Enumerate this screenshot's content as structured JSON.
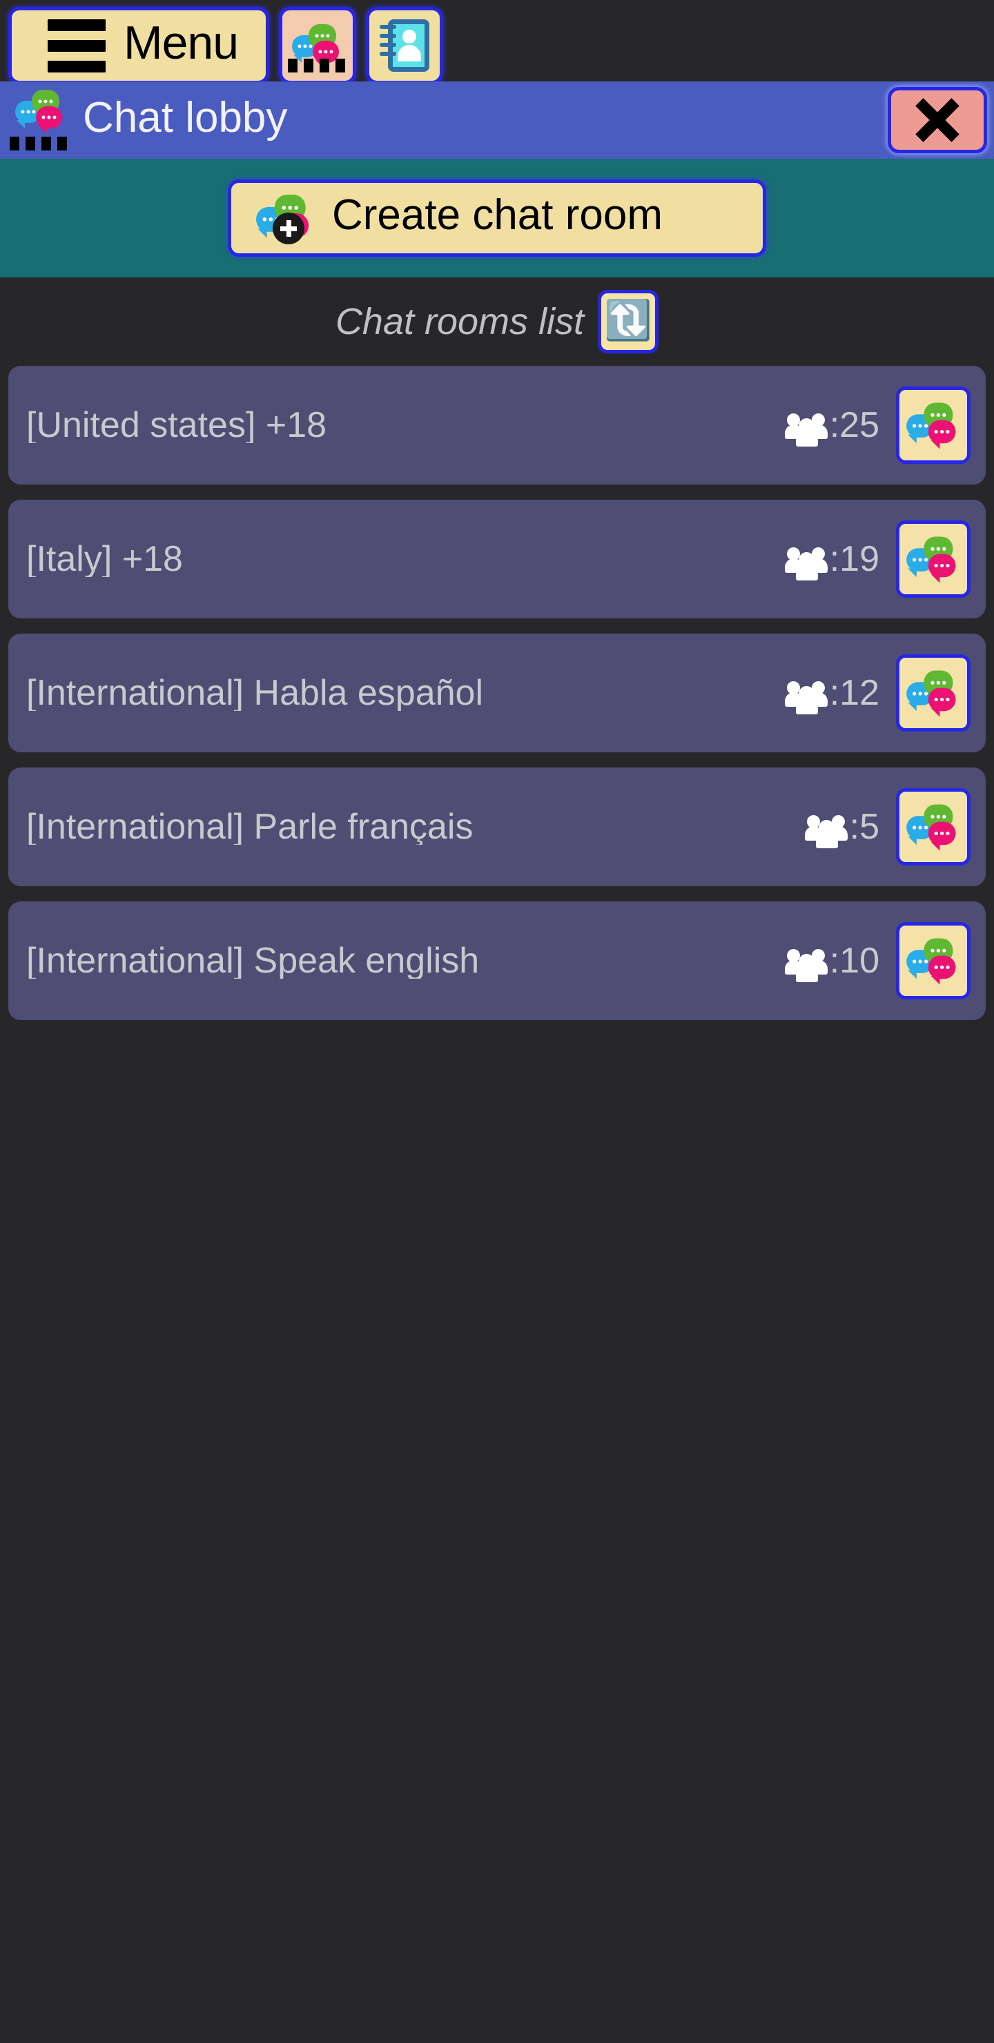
{
  "toolbar": {
    "menu_label": "Menu",
    "menu_icon": "hamburger-icon",
    "chat_icon": "chat-bubbles-icon",
    "contacts_icon": "contact-book-icon"
  },
  "lobby_header": {
    "title": "Chat lobby",
    "icon": "chat-bubbles-icon",
    "close_icon": "close-x-icon"
  },
  "create_band": {
    "button_label": "Create chat room",
    "button_icon": "chat-bubbles-plus-icon"
  },
  "list_header": {
    "title": "Chat rooms list",
    "refresh_icon": "refresh-icon",
    "refresh_glyph": "🔃"
  },
  "rooms": [
    {
      "name": "[United states] +18",
      "count": ":25",
      "users_icon": "users-group-icon",
      "thumb_icon": "chat-bubbles-icon"
    },
    {
      "name": "[Italy] +18",
      "count": ":19",
      "users_icon": "users-group-icon",
      "thumb_icon": "chat-bubbles-icon"
    },
    {
      "name": "[International] Habla español",
      "count": ":12",
      "users_icon": "users-group-icon",
      "thumb_icon": "chat-bubbles-icon"
    },
    {
      "name": "[International] Parle français",
      "count": ":5",
      "users_icon": "users-group-icon",
      "thumb_icon": "chat-bubbles-icon"
    },
    {
      "name": "[International] Speak english",
      "count": ":10",
      "users_icon": "users-group-icon",
      "thumb_icon": "chat-bubbles-icon"
    }
  ],
  "colors": {
    "page_background": "#272729",
    "header_blue": "#4B5CC1",
    "band_teal": "#186E73",
    "row_purple": "#4F4D74",
    "button_cream": "#F1DFA2",
    "button_border_blue": "#2626E6",
    "close_red": "#EE9C93",
    "text_light": "#C9C9CE"
  }
}
